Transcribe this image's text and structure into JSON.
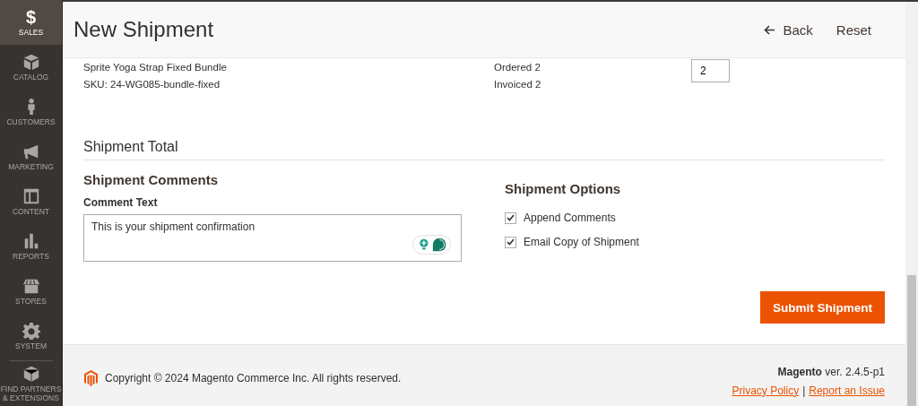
{
  "sidebar": {
    "items": [
      {
        "label": "SALES",
        "glyph": "$",
        "selected": true
      },
      {
        "label": "CATALOG",
        "selected": false
      },
      {
        "label": "CUSTOMERS",
        "selected": false
      },
      {
        "label": "MARKETING",
        "selected": false
      },
      {
        "label": "CONTENT",
        "selected": false
      },
      {
        "label": "REPORTS",
        "selected": false
      },
      {
        "label": "STORES",
        "selected": false
      },
      {
        "label": "SYSTEM",
        "selected": false
      },
      {
        "label": "FIND PARTNERS & EXTENSIONS",
        "selected": false
      }
    ]
  },
  "header": {
    "title": "New Shipment",
    "buttons": [
      {
        "label": "Back"
      },
      {
        "label": "Reset"
      }
    ]
  },
  "item": {
    "name": "Sprite Yoga Strap Fixed Bundle",
    "sku": "SKU: 24-WG085-bundle-fixed",
    "ordered": "Ordered 2",
    "invoiced": "Invoiced 2",
    "qty": "2"
  },
  "shipment_total": {
    "title": "Shipment Total"
  },
  "comments": {
    "title": "Shipment Comments",
    "label": "Comment Text",
    "value": "This is your shipment confirmation"
  },
  "options": {
    "title": "Shipment Options",
    "checkboxes": [
      {
        "label": "Append Comments",
        "checked": true
      },
      {
        "label": "Email Copy of Shipment",
        "checked": true
      }
    ]
  },
  "submit": "Submit Shipment",
  "footer": {
    "copyright": "Copyright © 2024 Magento Commerce Inc. All rights reserved.",
    "version": "**Magento** ver. 2.4.5-p1",
    "links": [
      "Privacy Policy",
      "Report an Issue"
    ],
    "separator": "|"
  }
}
